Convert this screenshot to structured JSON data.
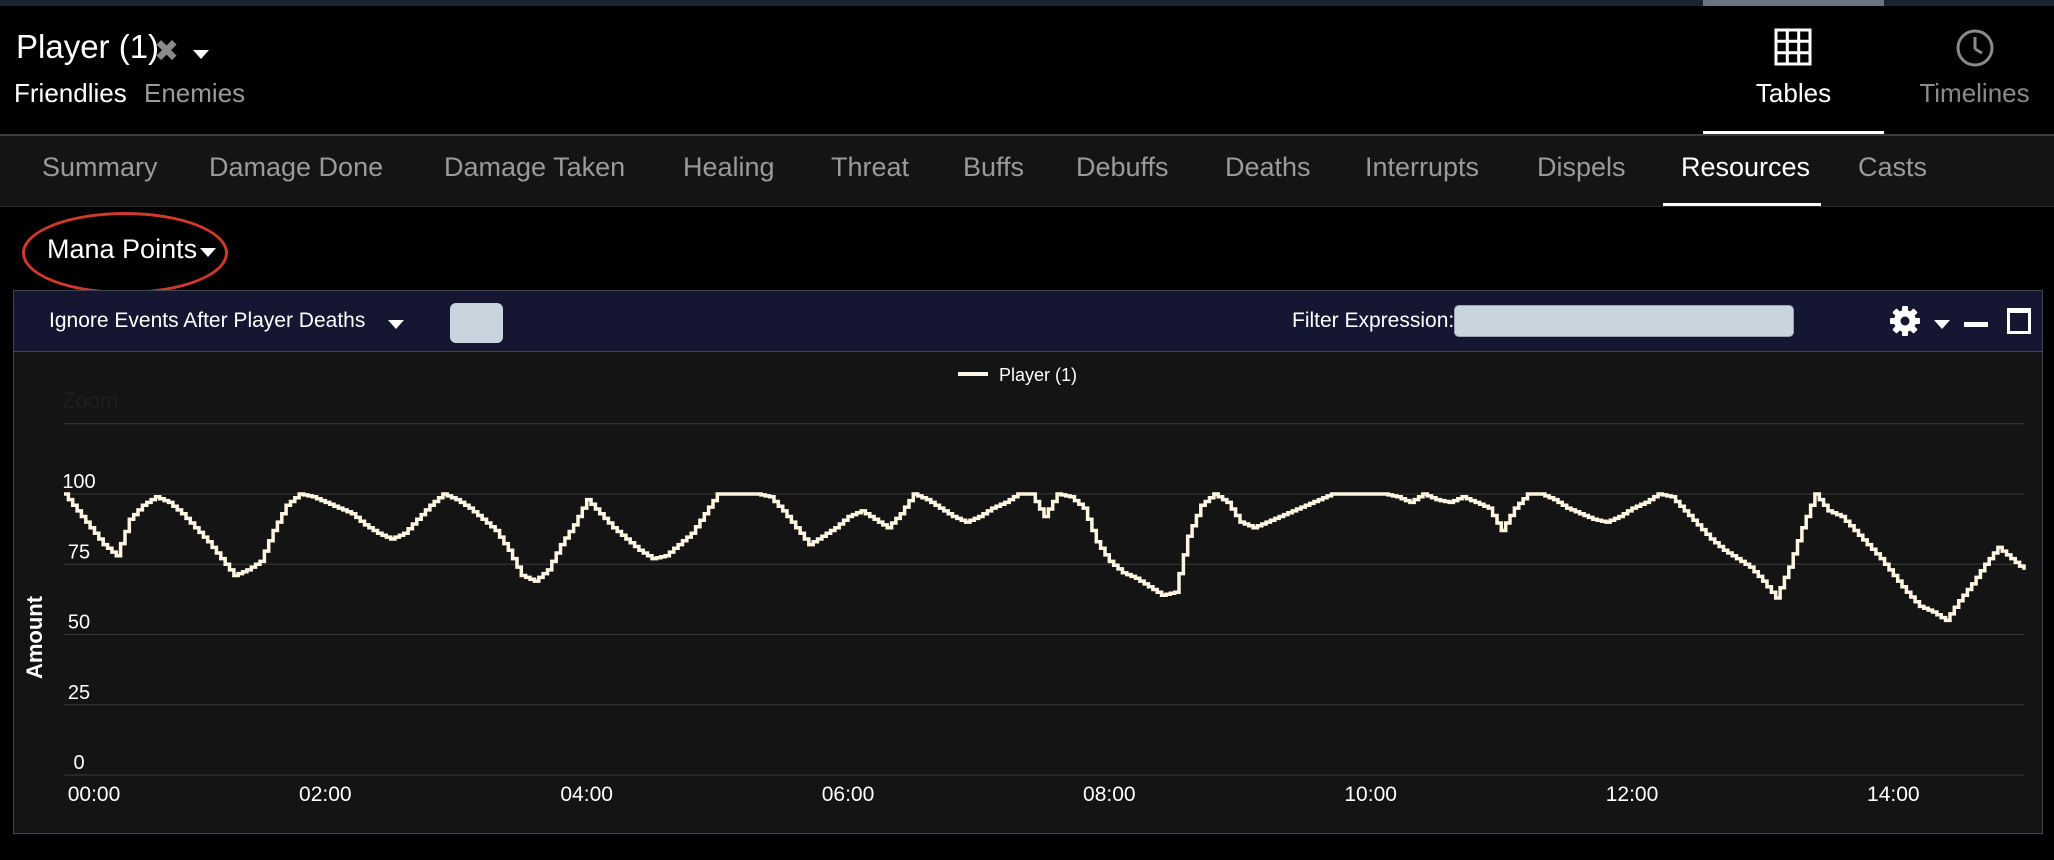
{
  "header": {
    "player_title": "Player (1)",
    "close_glyph": "✖",
    "subtabs": [
      "Friendlies",
      "Enemies"
    ]
  },
  "view_tabs": [
    {
      "label": "Tables",
      "icon": "grid-icon",
      "active": true
    },
    {
      "label": "Timelines",
      "icon": "clock-icon",
      "active": false
    }
  ],
  "nav_tabs": [
    "Summary",
    "Damage Done",
    "Damage Taken",
    "Healing",
    "Threat",
    "Buffs",
    "Debuffs",
    "Deaths",
    "Interrupts",
    "Dispels",
    "Resources",
    "Casts"
  ],
  "active_nav_tab": "Resources",
  "resource_select": "Mana Points",
  "toolbar": {
    "ignore_label": "Ignore Events After Player Deaths",
    "filter_label": "Filter Expression:",
    "filter_value": ""
  },
  "colors": {
    "line": "#fdf5e2",
    "annotation": "#d0392b",
    "toolbar_bg": "#151632"
  },
  "chart_data": {
    "type": "line",
    "zoom_label": "Zoom",
    "ylabel": "Amount",
    "ylim": [
      0,
      100
    ],
    "yticks": [
      0,
      25,
      50,
      75,
      100
    ],
    "xticks": [
      "00:00",
      "02:00",
      "04:00",
      "06:00",
      "08:00",
      "10:00",
      "12:00",
      "14:00"
    ],
    "x_unit": "minutes",
    "xlim": [
      0,
      15
    ],
    "legend": "top-center",
    "grid": true,
    "series": [
      {
        "name": "Player (1)",
        "step": true,
        "points": [
          [
            0.0,
            100
          ],
          [
            0.1,
            94
          ],
          [
            0.2,
            88
          ],
          [
            0.3,
            82
          ],
          [
            0.4,
            78
          ],
          [
            0.5,
            91
          ],
          [
            0.6,
            96
          ],
          [
            0.7,
            99
          ],
          [
            0.8,
            97
          ],
          [
            0.9,
            93
          ],
          [
            1.0,
            88
          ],
          [
            1.1,
            83
          ],
          [
            1.2,
            77
          ],
          [
            1.3,
            71
          ],
          [
            1.4,
            73
          ],
          [
            1.5,
            76
          ],
          [
            1.6,
            87
          ],
          [
            1.7,
            96
          ],
          [
            1.8,
            100
          ],
          [
            1.9,
            99
          ],
          [
            2.0,
            97
          ],
          [
            2.1,
            95
          ],
          [
            2.2,
            93
          ],
          [
            2.3,
            89
          ],
          [
            2.4,
            86
          ],
          [
            2.5,
            84
          ],
          [
            2.6,
            86
          ],
          [
            2.7,
            91
          ],
          [
            2.8,
            96
          ],
          [
            2.9,
            100
          ],
          [
            3.0,
            98
          ],
          [
            3.1,
            95
          ],
          [
            3.2,
            91
          ],
          [
            3.3,
            87
          ],
          [
            3.4,
            80
          ],
          [
            3.5,
            71
          ],
          [
            3.6,
            69
          ],
          [
            3.7,
            73
          ],
          [
            3.8,
            82
          ],
          [
            3.9,
            89
          ],
          [
            4.0,
            98
          ],
          [
            4.1,
            93
          ],
          [
            4.2,
            88
          ],
          [
            4.3,
            84
          ],
          [
            4.4,
            80
          ],
          [
            4.5,
            77
          ],
          [
            4.6,
            78
          ],
          [
            4.7,
            82
          ],
          [
            4.8,
            86
          ],
          [
            4.9,
            93
          ],
          [
            5.0,
            100
          ],
          [
            5.1,
            100
          ],
          [
            5.2,
            100
          ],
          [
            5.3,
            100
          ],
          [
            5.4,
            99
          ],
          [
            5.5,
            94
          ],
          [
            5.6,
            88
          ],
          [
            5.7,
            82
          ],
          [
            5.8,
            85
          ],
          [
            5.9,
            88
          ],
          [
            6.0,
            92
          ],
          [
            6.1,
            94
          ],
          [
            6.2,
            91
          ],
          [
            6.3,
            88
          ],
          [
            6.4,
            93
          ],
          [
            6.5,
            100
          ],
          [
            6.6,
            98
          ],
          [
            6.7,
            95
          ],
          [
            6.8,
            92
          ],
          [
            6.9,
            90
          ],
          [
            7.0,
            92
          ],
          [
            7.1,
            95
          ],
          [
            7.2,
            97
          ],
          [
            7.3,
            100
          ],
          [
            7.4,
            100
          ],
          [
            7.5,
            92
          ],
          [
            7.6,
            100
          ],
          [
            7.7,
            99
          ],
          [
            7.8,
            95
          ],
          [
            7.9,
            83
          ],
          [
            8.0,
            76
          ],
          [
            8.1,
            72
          ],
          [
            8.2,
            70
          ],
          [
            8.3,
            67
          ],
          [
            8.4,
            64
          ],
          [
            8.5,
            65
          ],
          [
            8.6,
            85
          ],
          [
            8.7,
            96
          ],
          [
            8.8,
            100
          ],
          [
            8.9,
            97
          ],
          [
            9.0,
            90
          ],
          [
            9.1,
            88
          ],
          [
            9.2,
            90
          ],
          [
            9.3,
            92
          ],
          [
            9.4,
            94
          ],
          [
            9.5,
            96
          ],
          [
            9.6,
            98
          ],
          [
            9.7,
            100
          ],
          [
            9.8,
            100
          ],
          [
            9.9,
            100
          ],
          [
            10.0,
            100
          ],
          [
            10.1,
            100
          ],
          [
            10.2,
            99
          ],
          [
            10.3,
            97
          ],
          [
            10.4,
            100
          ],
          [
            10.5,
            98
          ],
          [
            10.6,
            97
          ],
          [
            10.7,
            99
          ],
          [
            10.8,
            97
          ],
          [
            10.9,
            95
          ],
          [
            11.0,
            87
          ],
          [
            11.1,
            95
          ],
          [
            11.2,
            100
          ],
          [
            11.3,
            100
          ],
          [
            11.4,
            98
          ],
          [
            11.5,
            95
          ],
          [
            11.6,
            93
          ],
          [
            11.7,
            91
          ],
          [
            11.8,
            90
          ],
          [
            11.9,
            92
          ],
          [
            12.0,
            95
          ],
          [
            12.1,
            97
          ],
          [
            12.2,
            100
          ],
          [
            12.3,
            99
          ],
          [
            12.4,
            94
          ],
          [
            12.5,
            89
          ],
          [
            12.6,
            84
          ],
          [
            12.7,
            80
          ],
          [
            12.8,
            77
          ],
          [
            12.9,
            74
          ],
          [
            13.0,
            69
          ],
          [
            13.1,
            63
          ],
          [
            13.2,
            74
          ],
          [
            13.3,
            88
          ],
          [
            13.4,
            100
          ],
          [
            13.5,
            94
          ],
          [
            13.6,
            92
          ],
          [
            13.7,
            87
          ],
          [
            13.8,
            82
          ],
          [
            13.9,
            77
          ],
          [
            14.0,
            71
          ],
          [
            14.1,
            65
          ],
          [
            14.2,
            60
          ],
          [
            14.3,
            58
          ],
          [
            14.4,
            55
          ],
          [
            14.5,
            62
          ],
          [
            14.6,
            68
          ],
          [
            14.7,
            75
          ],
          [
            14.8,
            81
          ],
          [
            14.9,
            77
          ],
          [
            15.0,
            73
          ]
        ]
      }
    ]
  }
}
